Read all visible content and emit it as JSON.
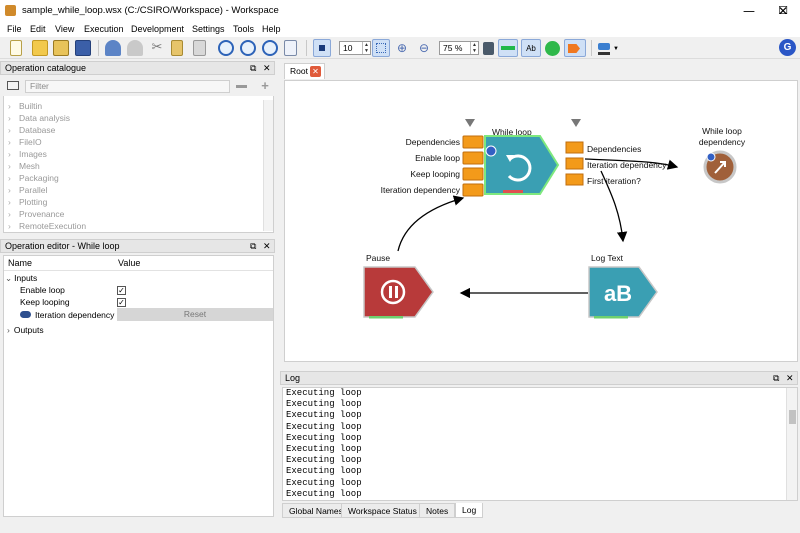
{
  "window": {
    "title": "sample_while_loop.wsx (C:/CSIRO/Workspace) - Workspace",
    "minimize": "—",
    "maximize": "☐",
    "close": "✕"
  },
  "menu": [
    "File",
    "Edit",
    "View",
    "Execution",
    "Development",
    "Settings",
    "Tools",
    "Help"
  ],
  "toolbar": {
    "grid_size": "10",
    "zoom": "75 %",
    "text_button": "Ab"
  },
  "catalogue": {
    "title": "Operation catalogue",
    "filter_placeholder": "Filter",
    "items": [
      "Builtin",
      "Data analysis",
      "Database",
      "FileIO",
      "Images",
      "Mesh",
      "Packaging",
      "Parallel",
      "Plotting",
      "Provenance",
      "RemoteExecution"
    ]
  },
  "op_editor": {
    "title": "Operation editor - While loop",
    "col_name": "Name",
    "col_value": "Value",
    "inputs_label": "Inputs",
    "enable_loop": "Enable loop",
    "keep_looping": "Keep looping",
    "iteration_dependency": "Iteration dependency",
    "reset": "Reset",
    "outputs_label": "Outputs",
    "enable_loop_checked": true,
    "keep_looping_checked": true
  },
  "canvas": {
    "tab_label": "Root",
    "while_loop": {
      "title": "While loop",
      "inputs": [
        "Dependencies",
        "Enable loop",
        "Keep looping",
        "Iteration dependency"
      ],
      "outputs": [
        "Dependencies",
        "Iteration dependency",
        "First iteration?"
      ]
    },
    "dependency_node": {
      "title_line1": "While loop",
      "title_line2": "dependency"
    },
    "pause": {
      "title": "Pause"
    },
    "log_text": {
      "title": "Log Text",
      "glyph": "aB"
    },
    "colors": {
      "teal": "#3a9fb3",
      "red": "#b83a3a",
      "orange": "#f39a1a",
      "brown": "#a0603a"
    }
  },
  "log": {
    "title": "Log",
    "lines": [
      "Executing loop",
      "Executing loop",
      "Executing loop",
      "Executing loop",
      "Executing loop",
      "Executing loop",
      "Executing loop",
      "Executing loop",
      "Executing loop",
      "Executing loop"
    ]
  },
  "bottom_tabs": [
    "Global Names",
    "Workspace Status",
    "Notes",
    "Log"
  ]
}
